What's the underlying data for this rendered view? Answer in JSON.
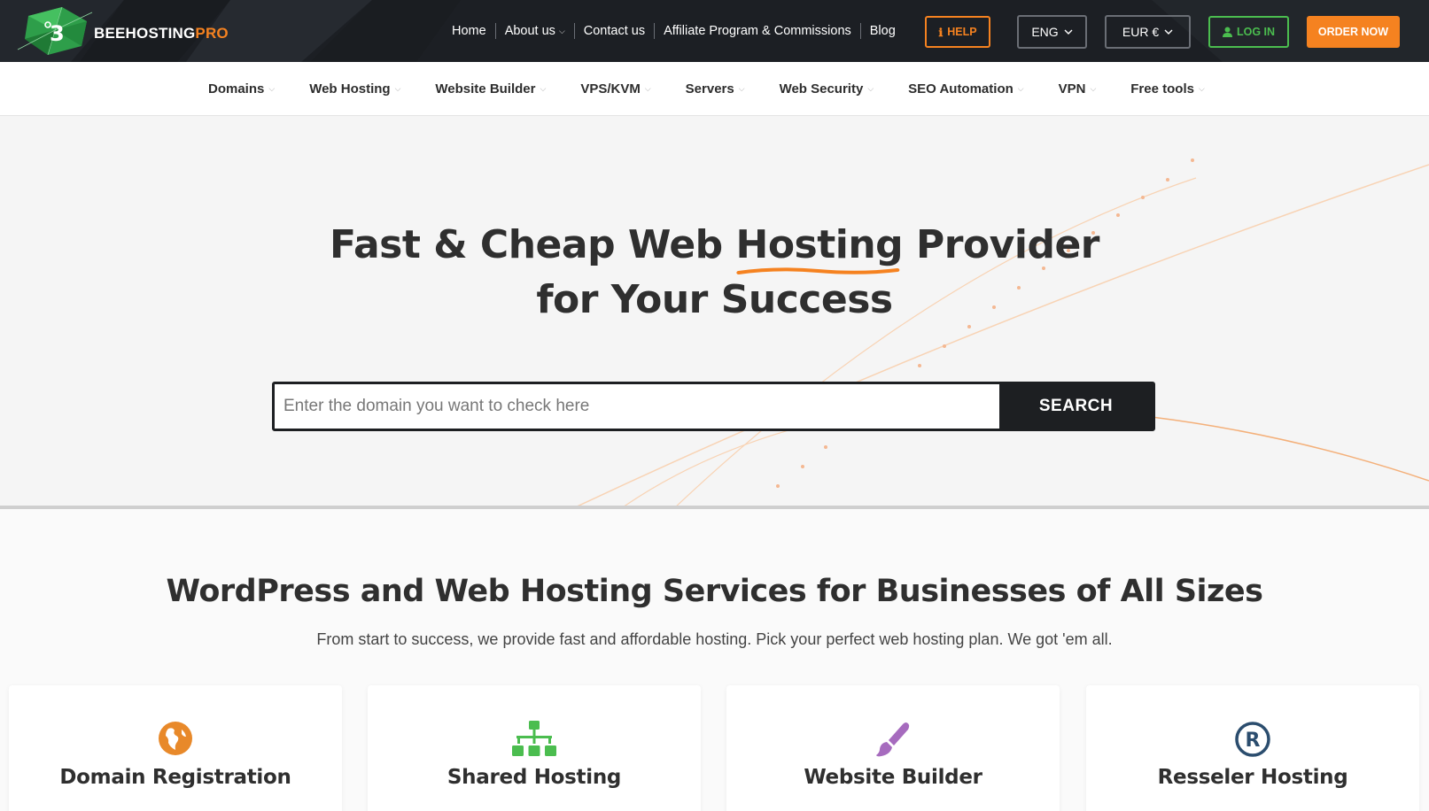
{
  "brand": {
    "name_main": "BEEHOSTING",
    "name_accent": "PRO"
  },
  "top_nav": [
    {
      "label": "Home",
      "has_dropdown": false
    },
    {
      "label": "About us",
      "has_dropdown": true
    },
    {
      "label": "Contact us",
      "has_dropdown": false
    },
    {
      "label": "Affiliate Program & Commissions",
      "has_dropdown": false
    },
    {
      "label": "Blog",
      "has_dropdown": false
    }
  ],
  "header_buttons": {
    "help": "HELP",
    "language": "ENG",
    "currency": "EUR €",
    "login": "LOG IN",
    "order": "ORDER NOW"
  },
  "main_nav": [
    {
      "label": "Domains"
    },
    {
      "label": "Web Hosting"
    },
    {
      "label": "Website Builder"
    },
    {
      "label": "VPS/KVM"
    },
    {
      "label": "Servers"
    },
    {
      "label": "Web Security"
    },
    {
      "label": "SEO Automation"
    },
    {
      "label": "VPN"
    },
    {
      "label": "Free tools"
    }
  ],
  "hero": {
    "title_part1": "Fast & Cheap Web ",
    "title_highlight": "Hosting",
    "title_part2": " Provider",
    "title_line2": "for Your Success",
    "search_placeholder": "Enter the domain you want to check here",
    "search_button": "SEARCH"
  },
  "services": {
    "heading": "WordPress and Web Hosting Services for Businesses of All Sizes",
    "subheading": "From start to success, we provide fast and affordable hosting. Pick your perfect web hosting plan. We got 'em all.",
    "cards": [
      {
        "title": "Domain Registration",
        "icon": "globe-icon"
      },
      {
        "title": "Shared Hosting",
        "icon": "sitemap-icon"
      },
      {
        "title": "Website Builder",
        "icon": "paintbrush-icon"
      },
      {
        "title": "Resseler Hosting",
        "icon": "registered-icon"
      }
    ]
  },
  "colors": {
    "accent_orange": "#f58220",
    "accent_green": "#4bbd4f",
    "dark": "#1d1f22",
    "icon_purple": "#a66bbe",
    "icon_navy": "#2b4d6e"
  }
}
